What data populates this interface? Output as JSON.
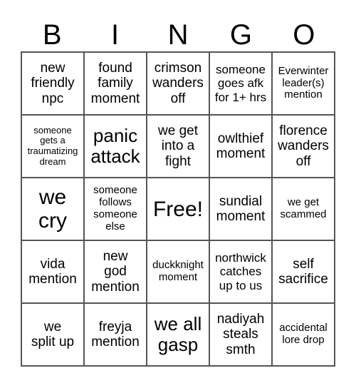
{
  "header": [
    "B",
    "I",
    "N",
    "G",
    "O"
  ],
  "cells": [
    [
      "new\nfriendly\nnpc",
      "found\nfamily\nmoment",
      "crimson\nwanders\noff",
      "someone\ngoes afk\nfor 1+ hrs",
      "Everwinter\nleader(s)\nmention"
    ],
    [
      "someone\ngets a\ntraumatizing\ndream",
      "panic\nattack",
      "we get\ninto a\nfight",
      "owlthief\nmoment",
      "florence\nwanders\noff"
    ],
    [
      "we\ncry",
      "someone\nfollows\nsomeone\nelse",
      "Free!",
      "sundial\nmoment",
      "we get\nscammed"
    ],
    [
      "vida\nmention",
      "new\ngod\nmention",
      "duckknight\nmoment",
      "northwick\ncatches\nup to us",
      "self\nsacrifice"
    ],
    [
      "we\nsplit up",
      "freyja\nmention",
      "we all\ngasp",
      "nadiyah\nsteals\nsmth",
      "accidental\nlore drop"
    ]
  ]
}
